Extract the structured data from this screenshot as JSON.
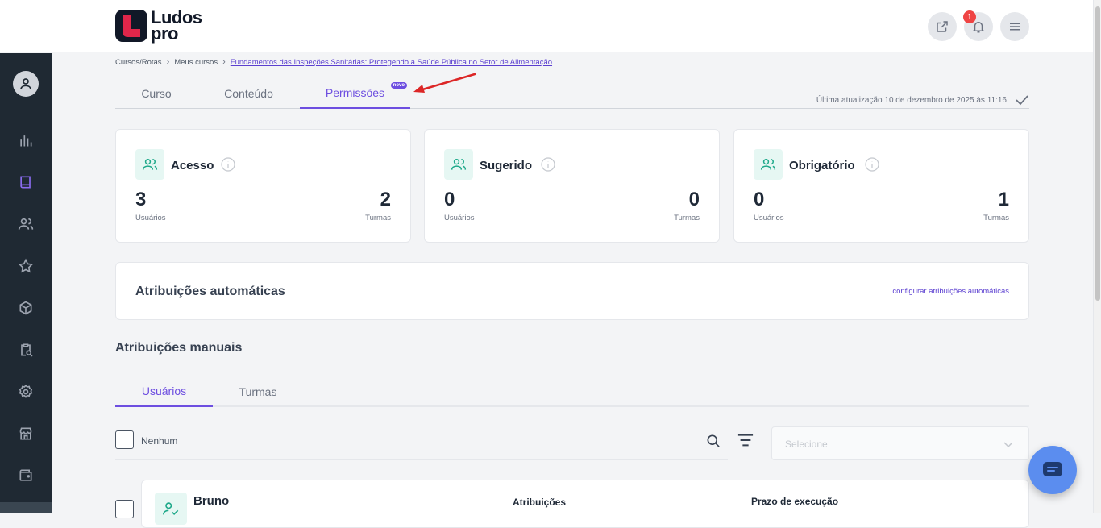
{
  "app": {
    "brand_line1": "Ludos",
    "brand_line2": "pro",
    "notification_count": "1",
    "colors": {
      "accent": "#6d4ee0",
      "sidebar": "#1f2933",
      "brand_red": "#e0264a",
      "teal": "#1fa98a",
      "chat": "#5b8def"
    }
  },
  "breadcrumb": {
    "items": [
      "Cursos/Rotas",
      "Meus cursos",
      "Fundamentos das Inspeções Sanitárias: Protegendo a Saúde Pública no Setor de Alimentação"
    ]
  },
  "tabs": [
    {
      "label": "Curso"
    },
    {
      "label": "Conteúdo"
    },
    {
      "label": "Permissões",
      "badge": "novo",
      "active": true
    }
  ],
  "last_update": "Última atualização 10 de dezembro de 2025 às 11:16",
  "stats": [
    {
      "title": "Acesso",
      "users": "3",
      "users_label": "Usuários",
      "groups": "2",
      "groups_label": "Turmas"
    },
    {
      "title": "Sugerido",
      "users": "0",
      "users_label": "Usuários",
      "groups": "0",
      "groups_label": "Turmas"
    },
    {
      "title": "Obrigatório",
      "users": "0",
      "users_label": "Usuários",
      "groups": "1",
      "groups_label": "Turmas"
    }
  ],
  "auto": {
    "title": "Atribuições automáticas",
    "link": "configurar atribuições automáticas"
  },
  "manual": {
    "title": "Atribuições manuais",
    "tabs": [
      {
        "label": "Usuários",
        "active": true
      },
      {
        "label": "Turmas"
      }
    ],
    "select_all_label": "Nenhum",
    "select_placeholder": "Selecione"
  },
  "rows": [
    {
      "name": "Bruno",
      "col2_header": "Atribuições",
      "col3_header": "Prazo de execução"
    }
  ]
}
